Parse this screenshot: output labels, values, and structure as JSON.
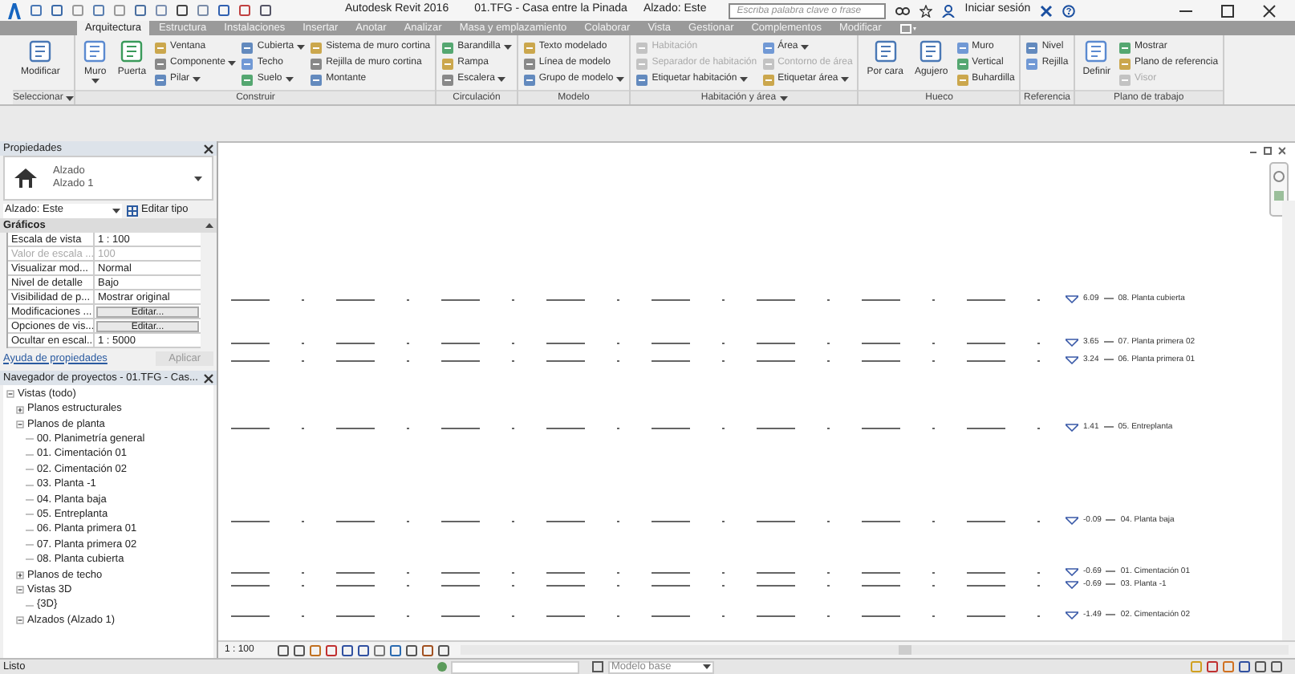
{
  "title_bar": {
    "app": "Autodesk Revit 2016",
    "document": "01.TFG - Casa entre la Pinada",
    "view": "Alzado: Este",
    "search_placeholder": "Escriba palabra clave o frase",
    "sign_in": "Iniciar sesión"
  },
  "tabs": [
    {
      "label": "Arquitectura",
      "selected": true
    },
    {
      "label": "Estructura",
      "selected": false
    },
    {
      "label": "Instalaciones",
      "selected": false
    },
    {
      "label": "Insertar",
      "selected": false
    },
    {
      "label": "Anotar",
      "selected": false
    },
    {
      "label": "Analizar",
      "selected": false
    },
    {
      "label": "Masa y emplazamiento",
      "selected": false
    },
    {
      "label": "Colaborar",
      "selected": false
    },
    {
      "label": "Vista",
      "selected": false
    },
    {
      "label": "Gestionar",
      "selected": false
    },
    {
      "label": "Complementos",
      "selected": false
    },
    {
      "label": "Modificar",
      "selected": false
    }
  ],
  "ribbon_groups": [
    {
      "label": "Seleccionar",
      "menu": true,
      "items": [
        {
          "label": "Modificar",
          "kind": "large",
          "menu": false,
          "disabled": false
        }
      ]
    },
    {
      "label": "Construir",
      "menu": false,
      "items": [
        {
          "label": "Muro",
          "kind": "large",
          "menu": true,
          "disabled": false
        },
        {
          "label": "Puerta",
          "kind": "large",
          "menu": false,
          "disabled": false
        },
        {
          "label": "Ventana",
          "kind": "small",
          "menu": false,
          "disabled": false
        },
        {
          "label": "Componente",
          "kind": "small",
          "menu": true,
          "disabled": false
        },
        {
          "label": "Pilar",
          "kind": "small",
          "menu": true,
          "disabled": false
        },
        {
          "label": "Cubierta",
          "kind": "small",
          "menu": true,
          "disabled": false
        },
        {
          "label": "Techo",
          "kind": "small",
          "menu": false,
          "disabled": false
        },
        {
          "label": "Suelo",
          "kind": "small",
          "menu": true,
          "disabled": false
        },
        {
          "label": "Sistema de muro cortina",
          "kind": "small",
          "menu": false,
          "disabled": false
        },
        {
          "label": "Rejilla de muro cortina",
          "kind": "small",
          "menu": false,
          "disabled": false
        },
        {
          "label": "Montante",
          "kind": "small",
          "menu": false,
          "disabled": false
        }
      ]
    },
    {
      "label": "Circulación",
      "menu": false,
      "items": [
        {
          "label": "Barandilla",
          "kind": "small",
          "menu": true,
          "disabled": false
        },
        {
          "label": "Rampa",
          "kind": "small",
          "menu": false,
          "disabled": false
        },
        {
          "label": "Escalera",
          "kind": "small",
          "menu": true,
          "disabled": false
        }
      ]
    },
    {
      "label": "Modelo",
      "menu": false,
      "items": [
        {
          "label": "Texto modelado",
          "kind": "small",
          "menu": false,
          "disabled": false
        },
        {
          "label": "Línea de modelo",
          "kind": "small",
          "menu": false,
          "disabled": false
        },
        {
          "label": "Grupo de modelo",
          "kind": "small",
          "menu": true,
          "disabled": false
        }
      ]
    },
    {
      "label": "Habitación y área",
      "menu": true,
      "items": [
        {
          "label": "Habitación",
          "kind": "small",
          "menu": false,
          "disabled": true
        },
        {
          "label": "Separador de habitación",
          "kind": "small",
          "menu": false,
          "disabled": true
        },
        {
          "label": "Etiquetar habitación",
          "kind": "small",
          "menu": true,
          "disabled": false
        },
        {
          "label": "Área",
          "kind": "small",
          "menu": true,
          "disabled": false
        },
        {
          "label": "Contorno de área",
          "kind": "small",
          "menu": false,
          "disabled": true
        },
        {
          "label": "Etiquetar área",
          "kind": "small",
          "menu": true,
          "disabled": false
        }
      ]
    },
    {
      "label": "Hueco",
      "menu": false,
      "items": [
        {
          "label": "Por cara",
          "kind": "large",
          "menu": false,
          "disabled": false
        },
        {
          "label": "Agujero",
          "kind": "large",
          "menu": false,
          "disabled": false
        },
        {
          "label": "Muro",
          "kind": "small",
          "menu": false,
          "disabled": false
        },
        {
          "label": "Vertical",
          "kind": "small",
          "menu": false,
          "disabled": false
        },
        {
          "label": "Buhardilla",
          "kind": "small",
          "menu": false,
          "disabled": false
        }
      ]
    },
    {
      "label": "Referencia",
      "menu": false,
      "items": [
        {
          "label": "Nivel",
          "kind": "small",
          "menu": false,
          "disabled": false
        },
        {
          "label": "Rejilla",
          "kind": "small",
          "menu": false,
          "disabled": false
        }
      ]
    },
    {
      "label": "Plano de trabajo",
      "menu": false,
      "items": [
        {
          "label": "Definir",
          "kind": "large",
          "menu": false,
          "disabled": false
        },
        {
          "label": "Mostrar",
          "kind": "small",
          "menu": false,
          "disabled": false
        },
        {
          "label": "Plano de referencia",
          "kind": "small",
          "menu": false,
          "disabled": false
        },
        {
          "label": "Visor",
          "kind": "small",
          "menu": false,
          "disabled": true
        }
      ]
    }
  ],
  "properties": {
    "title": "Propiedades",
    "type_family": "Alzado",
    "type_name": "Alzado 1",
    "instance": "Alzado: Este",
    "edit_type": "Editar tipo",
    "category": "Gráficos",
    "rows": [
      {
        "name": "Escala de vista",
        "value": "1 : 100",
        "kind": "text",
        "disabled": false
      },
      {
        "name": "Valor de escala ...",
        "value": "100",
        "kind": "text",
        "disabled": true
      },
      {
        "name": "Visualizar mod...",
        "value": "Normal",
        "kind": "text",
        "disabled": false
      },
      {
        "name": "Nivel de detalle",
        "value": "Bajo",
        "kind": "text",
        "disabled": false
      },
      {
        "name": "Visibilidad de p...",
        "value": "Mostrar original",
        "kind": "text",
        "disabled": false
      },
      {
        "name": "Modificaciones ...",
        "value": "Editar...",
        "kind": "button",
        "disabled": false
      },
      {
        "name": "Opciones de vis...",
        "value": "Editar...",
        "kind": "button",
        "disabled": false
      },
      {
        "name": "Ocultar en escal...",
        "value": "1 : 5000",
        "kind": "text",
        "disabled": false
      }
    ],
    "help_link": "Ayuda de propiedades",
    "apply": "Aplicar"
  },
  "project_browser": {
    "title": "Navegador de proyectos - 01.TFG - Cas...",
    "tree": [
      {
        "label": "Vistas (todo)",
        "expanded": true,
        "children": [
          {
            "label": "Planos estructurales",
            "expanded": false
          },
          {
            "label": "Planos de planta",
            "expanded": true,
            "children": [
              {
                "label": "00. Planimetría general"
              },
              {
                "label": "01. Cimentación 01"
              },
              {
                "label": "02. Cimentación 02"
              },
              {
                "label": "03. Planta -1"
              },
              {
                "label": "04. Planta baja"
              },
              {
                "label": "05. Entreplanta"
              },
              {
                "label": "06. Planta primera 01"
              },
              {
                "label": "07. Planta primera 02"
              },
              {
                "label": "08. Planta cubierta"
              }
            ]
          },
          {
            "label": "Planos de techo",
            "expanded": false
          },
          {
            "label": "Vistas 3D",
            "expanded": true,
            "children": [
              {
                "label": "{3D}"
              }
            ]
          },
          {
            "label": "Alzados (Alzado 1)",
            "expanded": true
          }
        ]
      }
    ]
  },
  "levels": [
    {
      "elevation": "6.09",
      "name": "08. Planta cubierta"
    },
    {
      "elevation": "3.65",
      "name": "07. Planta primera 02"
    },
    {
      "elevation": "3.24",
      "name": "06. Planta primera 01"
    },
    {
      "elevation": "1.41",
      "name": "05. Entreplanta"
    },
    {
      "elevation": "-0.09",
      "name": "04. Planta baja"
    },
    {
      "elevation": "-0.69",
      "name": "01. Cimentación 01"
    },
    {
      "elevation": "-0.69",
      "name": "03. Planta -1"
    },
    {
      "elevation": "-1.49",
      "name": "02. Cimentación 02"
    }
  ],
  "view_bar": {
    "scale": "1 : 100"
  },
  "status_bar": {
    "message": "Listo",
    "workset": "Modelo base"
  }
}
